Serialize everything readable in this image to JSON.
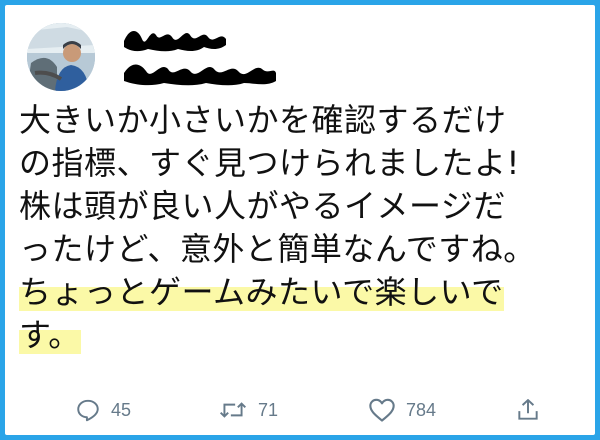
{
  "tweet": {
    "lines": [
      {
        "text": "大きいか小さいかを確認するだけ",
        "highlight": false
      },
      {
        "text": "の指標、すぐ見つけられましたよ!",
        "highlight": false
      },
      {
        "text": "株は頭が良い人がやるイメージだ",
        "highlight": false
      },
      {
        "text": "ったけど、意外と簡単なんですね。",
        "highlight": false
      },
      {
        "text": "ちょっとゲームみたいで楽しいで",
        "highlight": true
      },
      {
        "text": "す。",
        "highlight": true
      }
    ]
  },
  "actions": {
    "replies": "45",
    "retweets": "71",
    "likes": "784"
  },
  "icons": {
    "reply": "reply-icon",
    "retweet": "retweet-icon",
    "like": "heart-icon",
    "share": "share-icon"
  },
  "colors": {
    "frame": "#2aa4e8",
    "highlight": "#fbf9a7",
    "action": "#667a8a"
  }
}
